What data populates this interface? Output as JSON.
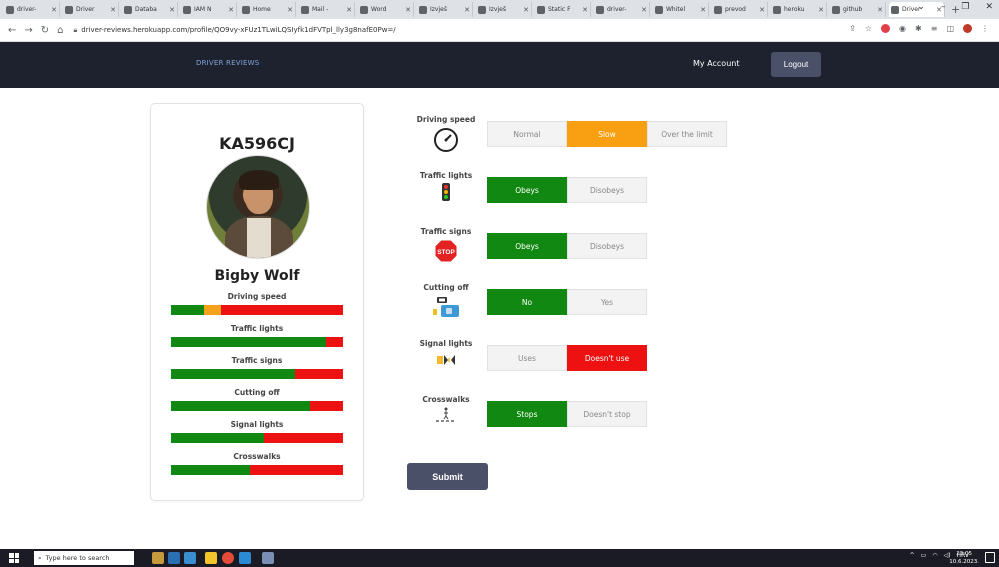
{
  "browser": {
    "tabs": [
      {
        "label": "driver-",
        "active": false
      },
      {
        "label": "Driver",
        "active": false
      },
      {
        "label": "Databa",
        "active": false
      },
      {
        "label": "IAM N",
        "active": false
      },
      {
        "label": "Home",
        "active": false
      },
      {
        "label": "Mail - ",
        "active": false
      },
      {
        "label": "Word",
        "active": false
      },
      {
        "label": "Izvješ",
        "active": false
      },
      {
        "label": "Izvješ",
        "active": false
      },
      {
        "label": "Static F",
        "active": false
      },
      {
        "label": "driver-",
        "active": false
      },
      {
        "label": "Whitel",
        "active": false
      },
      {
        "label": "prevod",
        "active": false
      },
      {
        "label": "heroku",
        "active": false
      },
      {
        "label": "github",
        "active": false
      },
      {
        "label": "Driver",
        "active": true
      }
    ],
    "url": "driver-reviews.herokuapp.com/profile/QO9vy-xFUz1TLwiLQSIyfk1dFVTpl_lly3g8nafE0Pw=/"
  },
  "navbar": {
    "brand": "DRIVER REVIEWS",
    "my_account": "My Account",
    "logout": "Logout"
  },
  "profile": {
    "plate": "KA596CJ",
    "name": "Bigby Wolf",
    "stats": [
      {
        "label": "Driving speed",
        "green": 0.19,
        "orange": 0.1,
        "red": 0.71
      },
      {
        "label": "Traffic lights",
        "green": 0.9,
        "orange": 0,
        "red": 0.1
      },
      {
        "label": "Traffic signs",
        "green": 0.72,
        "orange": 0,
        "red": 0.28
      },
      {
        "label": "Cutting off",
        "green": 0.81,
        "orange": 0,
        "red": 0.19
      },
      {
        "label": "Signal lights",
        "green": 0.54,
        "orange": 0,
        "red": 0.46
      },
      {
        "label": "Crosswalks",
        "green": 0.46,
        "orange": 0,
        "red": 0.54
      }
    ]
  },
  "questions": [
    {
      "label": "Driving speed",
      "icon": "speedometer-icon",
      "options": [
        "Normal",
        "Slow",
        "Over the limit"
      ],
      "selected": 1,
      "selected_color": "orange"
    },
    {
      "label": "Traffic lights",
      "icon": "traffic-light-icon",
      "options": [
        "Obeys",
        "Disobeys"
      ],
      "selected": 0,
      "selected_color": "green"
    },
    {
      "label": "Traffic signs",
      "icon": "stop-sign-icon",
      "icon_text": "STOP",
      "options": [
        "Obeys",
        "Disobeys"
      ],
      "selected": 0,
      "selected_color": "green"
    },
    {
      "label": "Cutting off",
      "icon": "cutting-off-icon",
      "options": [
        "No",
        "Yes"
      ],
      "selected": 0,
      "selected_color": "green"
    },
    {
      "label": "Signal lights",
      "icon": "signal-lights-icon",
      "options": [
        "Uses",
        "Doesn't use"
      ],
      "selected": 1,
      "selected_color": "red"
    },
    {
      "label": "Crosswalks",
      "icon": "crosswalk-icon",
      "options": [
        "Stops",
        "Doesn't stop"
      ],
      "selected": 0,
      "selected_color": "green"
    }
  ],
  "submit_label": "Submit",
  "taskbar": {
    "search_placeholder": "Type here to search",
    "tray_lang": "HRV",
    "time": "23:05",
    "date": "10.6.2023."
  },
  "colors": {
    "green": "#118811",
    "orange": "#f8a012",
    "red": "#ee1111",
    "navbar": "#1e222f",
    "button": "#4a5068"
  }
}
